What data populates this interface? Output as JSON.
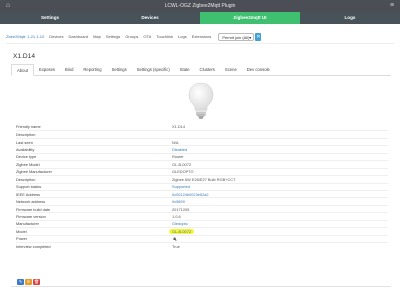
{
  "window": {
    "title": "LCWL-OGZ Zigbee2Mqtt Plugin"
  },
  "nav": [
    {
      "label": "Settings",
      "active": false
    },
    {
      "label": "Devices",
      "active": false
    },
    {
      "label": "Zigbee2mqtt UI",
      "active": true
    },
    {
      "label": "Logs",
      "active": false
    }
  ],
  "toolbar": {
    "brand": "Zbee2Mqtt: 1.21.1-10",
    "links": [
      "Devices",
      "Dashboard",
      "Map",
      "Settings",
      "Groups",
      "OTA",
      "Touchlink",
      "Logs",
      "Extensions"
    ],
    "permit_select": "Permit join (All)",
    "permit_button": "✕"
  },
  "device": {
    "title": "X1.D14",
    "tabs": [
      "About",
      "Exposes",
      "Bind",
      "Reporting",
      "Settings",
      "Settings (specific)",
      "State",
      "Clusters",
      "Scene",
      "Dev console"
    ],
    "active_tab": "About"
  },
  "properties": [
    {
      "key": "Friendly name",
      "value": "X1.D14",
      "style": "plain"
    },
    {
      "key": "Description",
      "value": "",
      "style": "plain"
    },
    {
      "key": "Last seen",
      "value": "N/A",
      "style": "plain"
    },
    {
      "key": "Availability",
      "value": "Disabled",
      "style": "link"
    },
    {
      "key": "Device type",
      "value": "Router",
      "style": "plain"
    },
    {
      "key": "Zigbee Model",
      "value": "GL-B-007Z",
      "style": "plain"
    },
    {
      "key": "Zigbee Manufacturer",
      "value": "GLEDOPTO",
      "style": "plain"
    },
    {
      "key": "Description",
      "value": "Zigbee 6W E26/E27 Bulb RGB+CCT",
      "style": "plain"
    },
    {
      "key": "Support status",
      "value": "Supported",
      "style": "link"
    },
    {
      "key": "IEEE Address",
      "value": "0x00124b0023e52a2",
      "style": "link"
    },
    {
      "key": "Network address",
      "value": "0x5899",
      "style": "link"
    },
    {
      "key": "Firmware build date",
      "value": "20171205",
      "style": "plain"
    },
    {
      "key": "Firmware version",
      "value": "1.0.6",
      "style": "plain"
    },
    {
      "key": "Manufacturer",
      "value": "Gledopto",
      "style": "link"
    },
    {
      "key": "Model",
      "value": "GL-B-007Z",
      "style": "hl"
    },
    {
      "key": "Power",
      "value": "🔌",
      "style": "plain"
    },
    {
      "key": "Interview completed",
      "value": "True",
      "style": "plain"
    }
  ],
  "actions": [
    {
      "name": "edit-button",
      "glyph": "✎",
      "color": "blue"
    },
    {
      "name": "reconfigure-button",
      "glyph": "⟳",
      "color": "orange"
    },
    {
      "name": "remove-button",
      "glyph": "🗑",
      "color": "red"
    }
  ]
}
